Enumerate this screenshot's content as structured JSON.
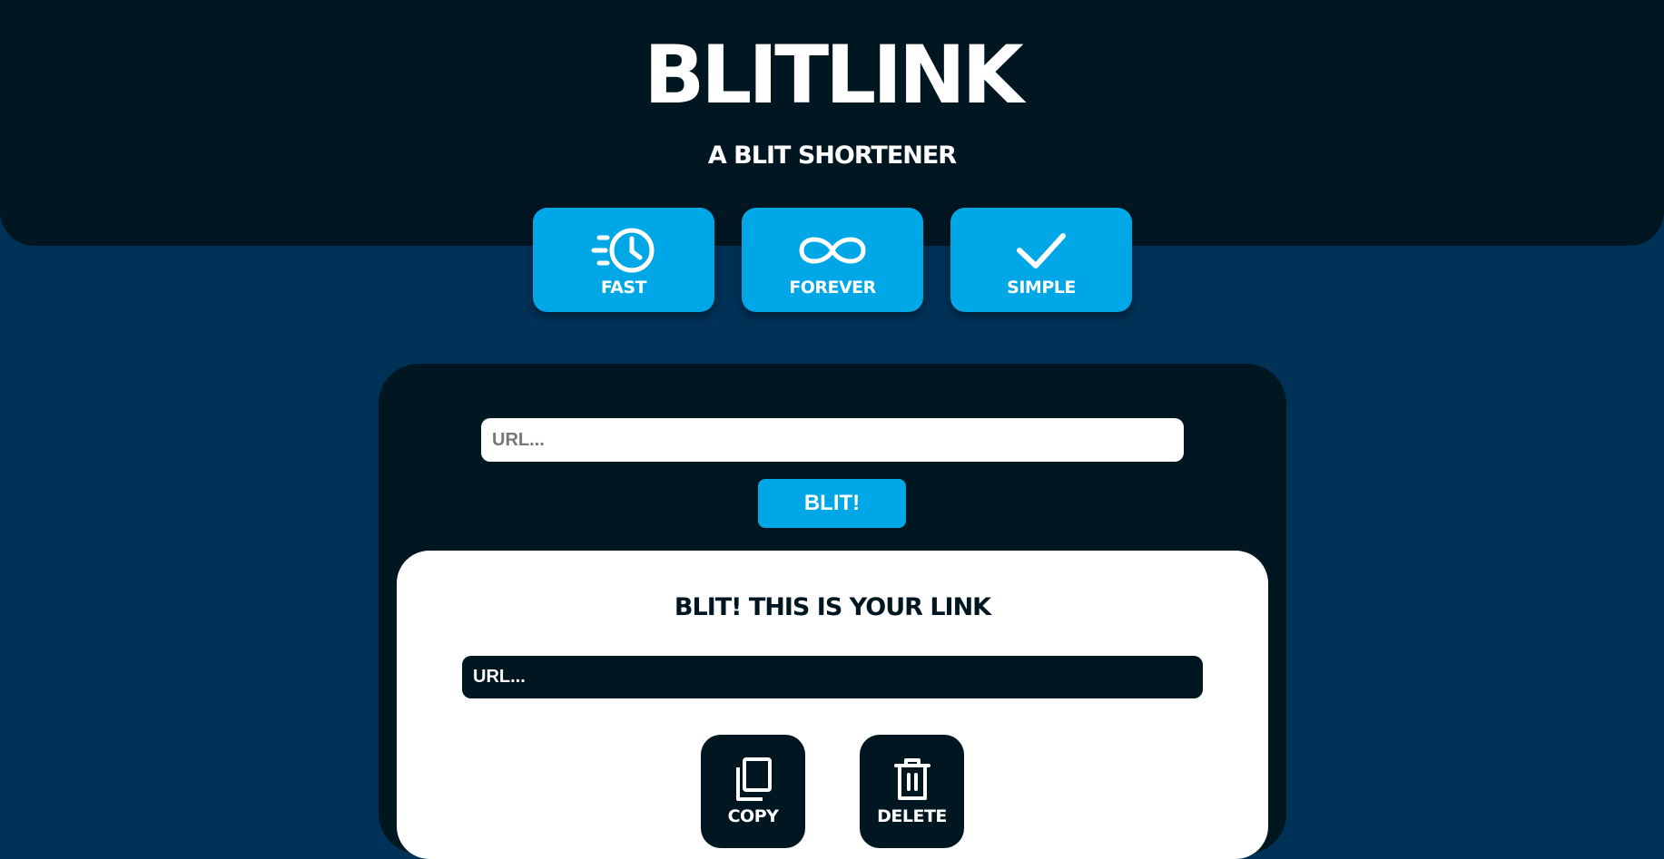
{
  "header": {
    "title": "BLITLINK",
    "subtitle": "A BLIT SHORTENER"
  },
  "features": [
    {
      "label": "FAST",
      "icon": "fast-clock-icon"
    },
    {
      "label": "FOREVER",
      "icon": "infinity-icon"
    },
    {
      "label": "SIMPLE",
      "icon": "checkmark-icon"
    }
  ],
  "form": {
    "url_placeholder": "URL...",
    "submit_label": "BLIT!"
  },
  "result": {
    "title": "BLIT! THIS IS YOUR LINK",
    "url_text": "URL...",
    "copy_label": "COPY",
    "delete_label": "DELETE"
  },
  "colors": {
    "page_background": "#003157",
    "dark_navy": "#001621",
    "accent_blue": "#00a7e6",
    "white": "#ffffff"
  }
}
